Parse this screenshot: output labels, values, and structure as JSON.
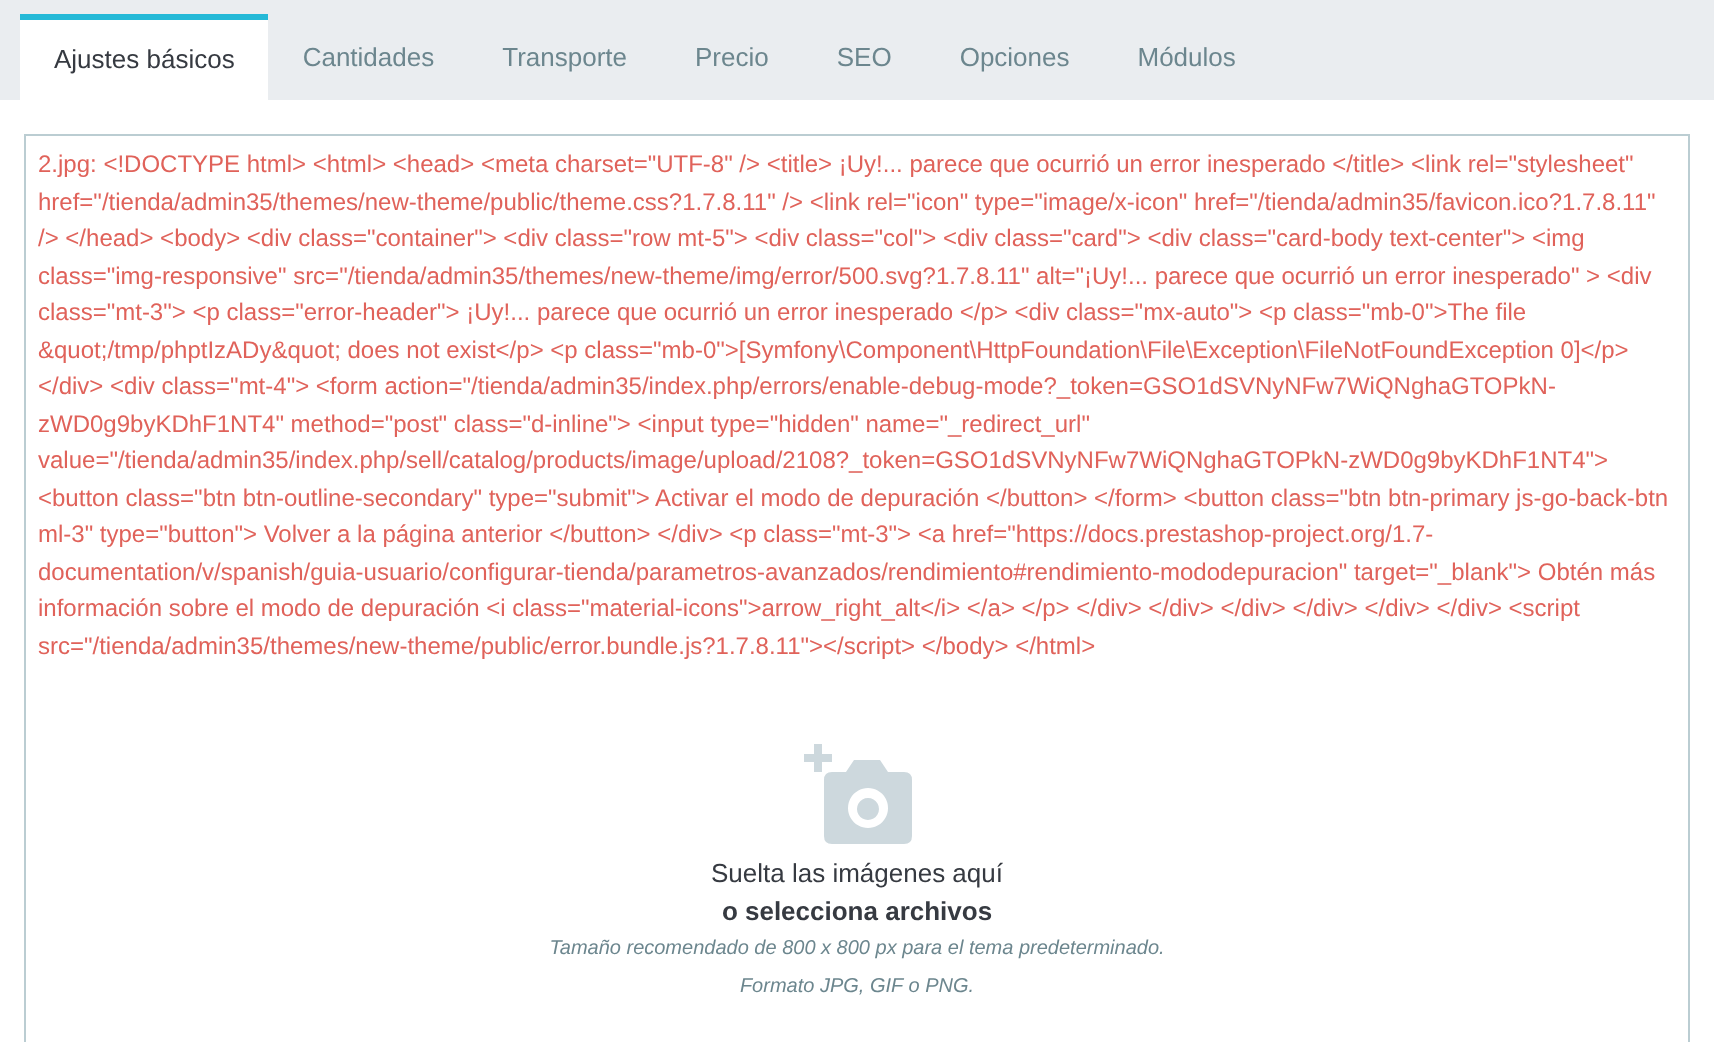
{
  "tabs": [
    {
      "label": "Ajustes básicos",
      "selected": true
    },
    {
      "label": "Cantidades",
      "selected": false
    },
    {
      "label": "Transporte",
      "selected": false
    },
    {
      "label": "Precio",
      "selected": false
    },
    {
      "label": "SEO",
      "selected": false
    },
    {
      "label": "Opciones",
      "selected": false
    },
    {
      "label": "Módulos",
      "selected": false
    }
  ],
  "error_message": "2.jpg: <!DOCTYPE html> <html> <head> <meta charset=\"UTF-8\" /> <title> ¡Uy!... parece que ocurrió un error inesperado </title> <link rel=\"stylesheet\" href=\"/tienda/admin35/themes/new-theme/public/theme.css?1.7.8.11\" /> <link rel=\"icon\" type=\"image/x-icon\" href=\"/tienda/admin35/favicon.ico?1.7.8.11\" /> </head> <body> <div class=\"container\"> <div class=\"row mt-5\"> <div class=\"col\"> <div class=\"card\"> <div class=\"card-body text-center\"> <img class=\"img-responsive\" src=\"/tienda/admin35/themes/new-theme/img/error/500.svg?1.7.8.11\" alt=\"¡Uy!... parece que ocurrió un error inesperado\" > <div class=\"mt-3\"> <p class=\"error-header\"> ¡Uy!... parece que ocurrió un error inesperado </p> <div class=\"mx-auto\"> <p class=\"mb-0\">The file &quot;/tmp/phptIzADy&quot; does not exist</p> <p class=\"mb-0\">[Symfony\\Component\\HttpFoundation\\File\\Exception\\FileNotFoundException 0]</p> </div> <div class=\"mt-4\"> <form action=\"/tienda/admin35/index.php/errors/enable-debug-mode?_token=GSO1dSVNyNFw7WiQNghaGTOPkN-zWD0g9byKDhF1NT4\" method=\"post\" class=\"d-inline\"> <input type=\"hidden\" name=\"_redirect_url\" value=\"/tienda/admin35/index.php/sell/catalog/products/image/upload/2108?_token=GSO1dSVNyNFw7WiQNghaGTOPkN-zWD0g9byKDhF1NT4\"> <button class=\"btn btn-outline-secondary\" type=\"submit\"> Activar el modo de depuración </button> </form> <button class=\"btn btn-primary js-go-back-btn ml-3\" type=\"button\"> Volver a la página anterior </button> </div> <p class=\"mt-3\"> <a href=\"https://docs.prestashop-project.org/1.7-documentation/v/spanish/guia-usuario/configurar-tienda/parametros-avanzados/rendimiento#rendimiento-mododepuracion\" target=\"_blank\"> Obtén más información sobre el modo de depuración <i class=\"material-icons\">arrow_right_alt</i> </a> </p> </div> </div> </div> </div> </div> </div> <script src=\"/tienda/admin35/themes/new-theme/public/error.bundle.js?1.7.8.11\"></script> </body> </html>",
  "dropzone": {
    "title": "Suelta las imágenes aquí",
    "link": "o selecciona archivos",
    "hints": [
      "Tamaño recomendado de 800 x 800 px para el tema predeterminado.",
      "Formato JPG, GIF o PNG."
    ]
  }
}
